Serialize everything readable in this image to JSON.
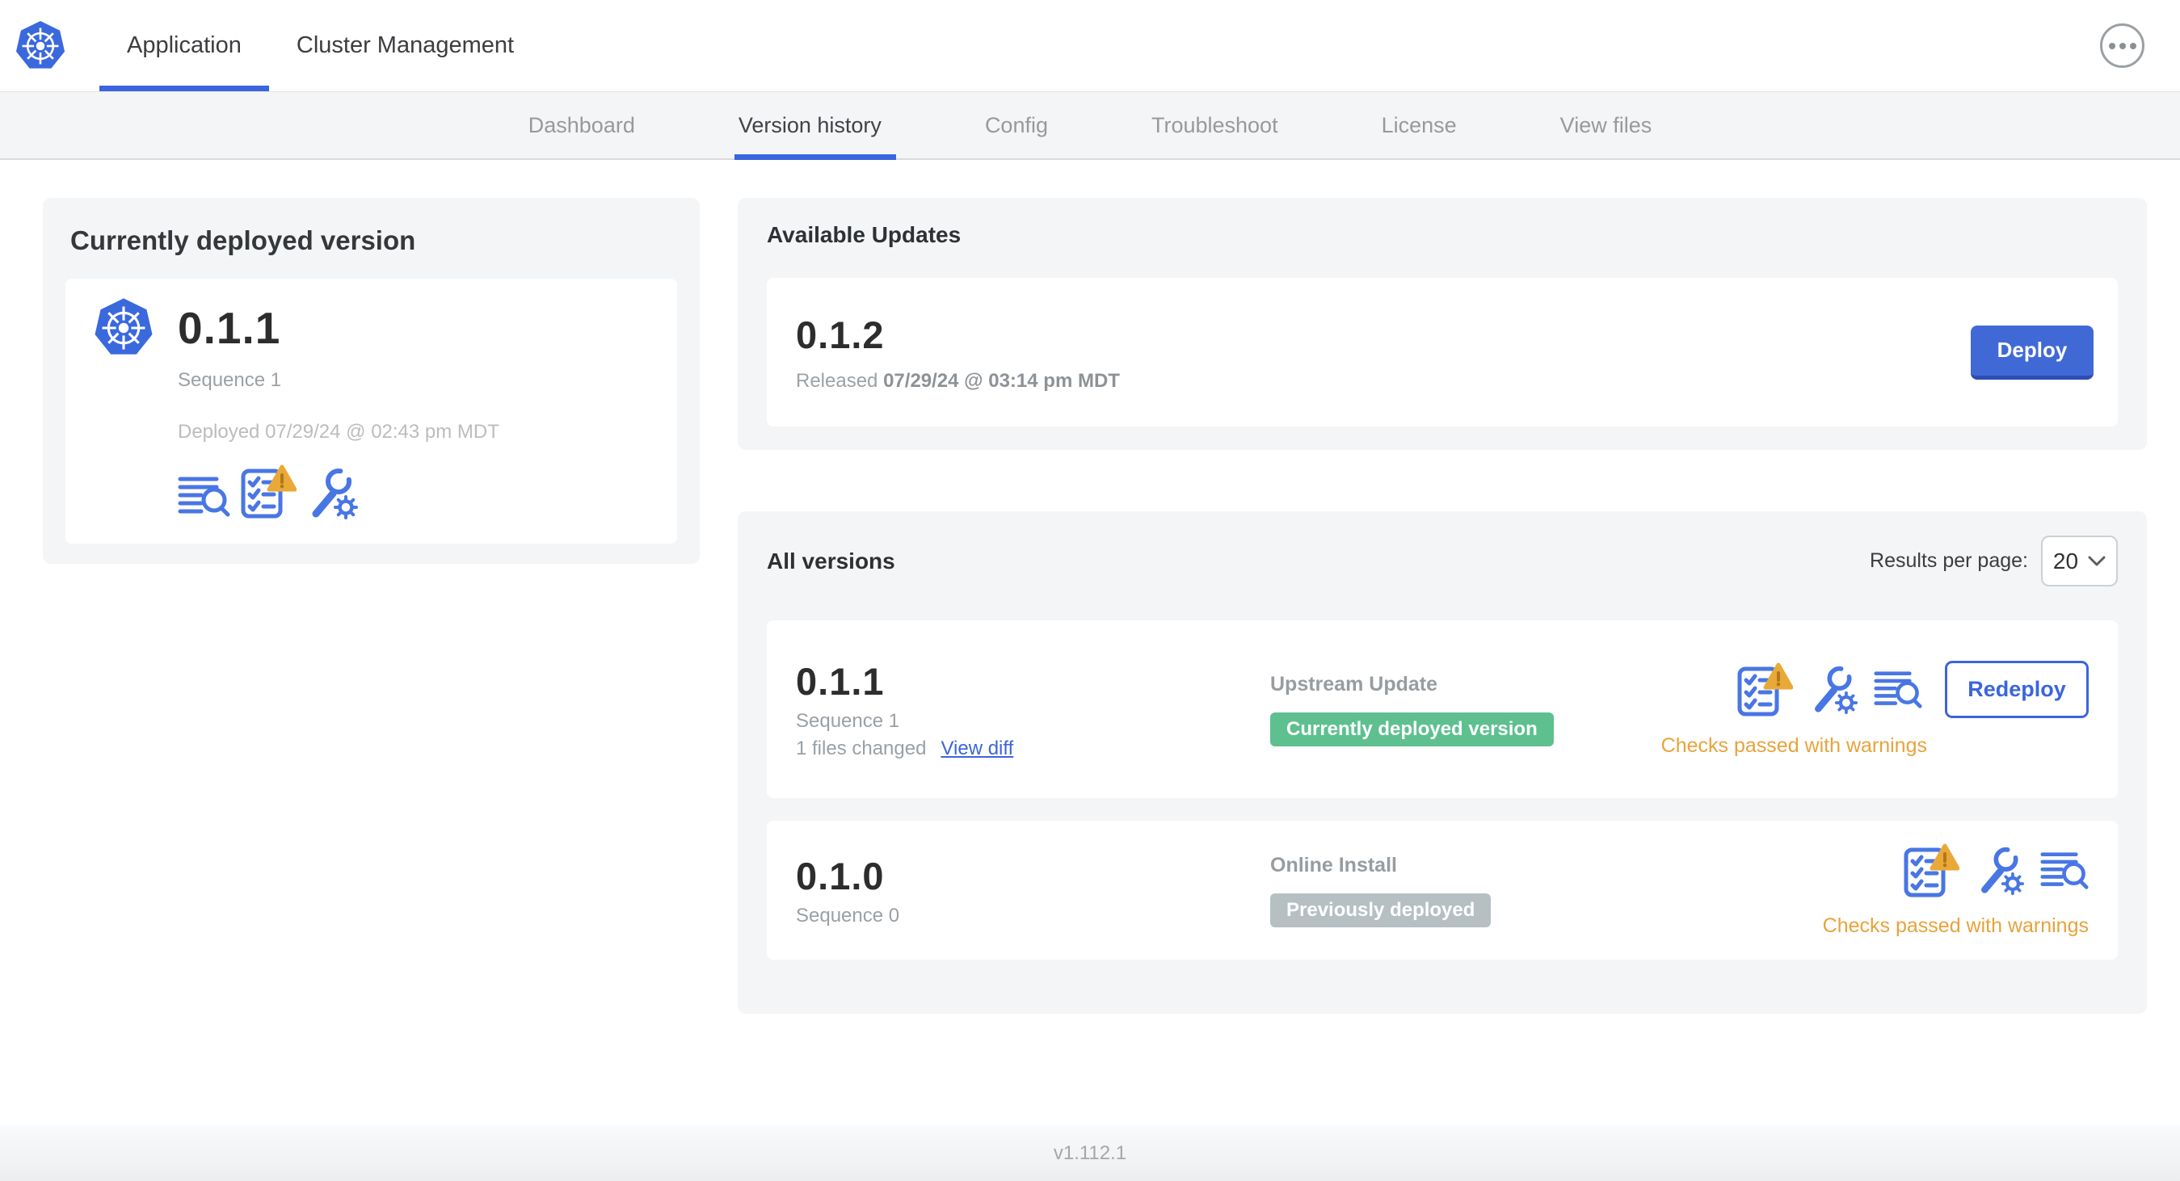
{
  "colors": {
    "accent_blue": "#3b65de",
    "k8s_logo_blue": "#3a68dd",
    "deploy_button_blue": "#4169d6",
    "badge_green": "#5ec08f",
    "badge_gray": "#b6c0c3",
    "warning_orange": "#e8a33b",
    "card_gray": "#f4f5f7"
  },
  "top_nav": {
    "logo_icon": "kubernetes-logo",
    "tabs": [
      {
        "label": "Application",
        "active": true
      },
      {
        "label": "Cluster Management",
        "active": false
      }
    ],
    "menu_icon": "ellipsis-icon"
  },
  "sub_nav": {
    "tabs": [
      {
        "label": "Dashboard",
        "active": false
      },
      {
        "label": "Version history",
        "active": true
      },
      {
        "label": "Config",
        "active": false
      },
      {
        "label": "Troubleshoot",
        "active": false
      },
      {
        "label": "License",
        "active": false
      },
      {
        "label": "View files",
        "active": false
      }
    ]
  },
  "current_version_card": {
    "title": "Currently deployed version",
    "version": "0.1.1",
    "sequence": "Sequence 1",
    "deployed": "Deployed 07/29/24 @ 02:43 pm MDT",
    "icons": [
      "release-notes-icon",
      "preflight-checks-warning-icon",
      "config-icon"
    ]
  },
  "available_updates": {
    "title": "Available Updates",
    "update": {
      "version": "0.1.2",
      "released_prefix": "Released",
      "released_date": "07/29/24 @ 03:14 pm MDT",
      "deploy_label": "Deploy"
    }
  },
  "all_versions": {
    "title": "All versions",
    "results_per_page_label": "Results per page:",
    "results_per_page_value": "20",
    "rows": [
      {
        "version": "0.1.1",
        "sequence": "Sequence 1",
        "files_changed": "1 files changed",
        "view_diff_label": "View diff",
        "source": "Upstream Update",
        "status_badge": "Currently deployed version",
        "badge_type": "green",
        "icons": [
          "preflight-checks-warning-icon",
          "config-icon",
          "release-notes-icon"
        ],
        "action_label": "Redeploy",
        "check_status": "Checks passed with warnings"
      },
      {
        "version": "0.1.0",
        "sequence": "Sequence 0",
        "source": "Online Install",
        "status_badge": "Previously deployed",
        "badge_type": "gray",
        "icons": [
          "preflight-checks-warning-icon",
          "config-icon",
          "release-notes-icon"
        ],
        "check_status": "Checks passed with warnings"
      }
    ]
  },
  "footer": {
    "version": "v1.112.1"
  }
}
